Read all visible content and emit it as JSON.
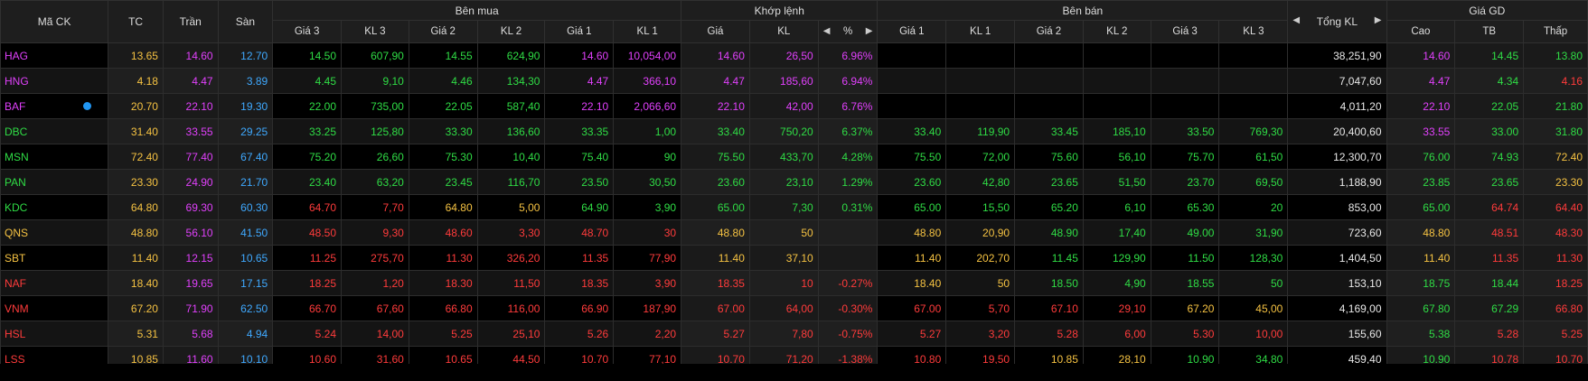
{
  "headers": {
    "symbol": "Mã CK",
    "ref": "TC",
    "ceil": "Trần",
    "floor": "Sàn",
    "buy_group": "Bên mua",
    "match_group": "Khớp lệnh",
    "sell_group": "Bên bán",
    "total": "Tổng KL",
    "price_group": "Giá GD",
    "buy": [
      "Giá 3",
      "KL 3",
      "Giá 2",
      "KL 2",
      "Giá 1",
      "KL 1"
    ],
    "match": [
      "Giá",
      "KL",
      "%"
    ],
    "sell": [
      "Giá 1",
      "KL 1",
      "Giá 2",
      "KL 2",
      "Giá 3",
      "KL 3"
    ],
    "price": [
      "Cao",
      "TB",
      "Thấp"
    ]
  },
  "colors": {
    "ceil": "#e040fb",
    "floor": "#3fa9ff",
    "ref": "#f5c242",
    "up": "#2fdc45",
    "down": "#ff3b3b"
  },
  "rows": [
    {
      "s": "HAG",
      "i": false,
      "ref": "13.65",
      "ceil": "14.60",
      "floor": "12.70",
      "b": [
        "14.50",
        "607,90",
        "14.55",
        "624,90",
        "14.60",
        "10,054,00"
      ],
      "m": [
        "14.60",
        "26,50",
        "6.96%"
      ],
      "a": [
        "",
        "",
        "",
        "",
        "",
        ""
      ],
      "tot": "38,251,90",
      "h": "14.60",
      "avg": "14.45",
      "l": "13.80"
    },
    {
      "s": "HNG",
      "i": false,
      "ref": "4.18",
      "ceil": "4.47",
      "floor": "3.89",
      "b": [
        "4.45",
        "9,10",
        "4.46",
        "134,30",
        "4.47",
        "366,10"
      ],
      "m": [
        "4.47",
        "185,60",
        "6.94%"
      ],
      "a": [
        "",
        "",
        "",
        "",
        "",
        ""
      ],
      "tot": "7,047,60",
      "h": "4.47",
      "avg": "4.34",
      "l": "4.16"
    },
    {
      "s": "BAF",
      "i": true,
      "ref": "20.70",
      "ceil": "22.10",
      "floor": "19.30",
      "b": [
        "22.00",
        "735,00",
        "22.05",
        "587,40",
        "22.10",
        "2,066,60"
      ],
      "m": [
        "22.10",
        "42,00",
        "6.76%"
      ],
      "a": [
        "",
        "",
        "",
        "",
        "",
        ""
      ],
      "tot": "4,011,20",
      "h": "22.10",
      "avg": "22.05",
      "l": "21.80"
    },
    {
      "s": "DBC",
      "i": false,
      "ref": "31.40",
      "ceil": "33.55",
      "floor": "29.25",
      "b": [
        "33.25",
        "125,80",
        "33.30",
        "136,60",
        "33.35",
        "1,00"
      ],
      "m": [
        "33.40",
        "750,20",
        "6.37%"
      ],
      "a": [
        "33.40",
        "119,90",
        "33.45",
        "185,10",
        "33.50",
        "769,30"
      ],
      "tot": "20,400,60",
      "h": "33.55",
      "avg": "33.00",
      "l": "31.80"
    },
    {
      "s": "MSN",
      "i": false,
      "ref": "72.40",
      "ceil": "77.40",
      "floor": "67.40",
      "b": [
        "75.20",
        "26,60",
        "75.30",
        "10,40",
        "75.40",
        "90"
      ],
      "m": [
        "75.50",
        "433,70",
        "4.28%"
      ],
      "a": [
        "75.50",
        "72,00",
        "75.60",
        "56,10",
        "75.70",
        "61,50"
      ],
      "tot": "12,300,70",
      "h": "76.00",
      "avg": "74.93",
      "l": "72.40"
    },
    {
      "s": "PAN",
      "i": false,
      "ref": "23.30",
      "ceil": "24.90",
      "floor": "21.70",
      "b": [
        "23.40",
        "63,20",
        "23.45",
        "116,70",
        "23.50",
        "30,50"
      ],
      "m": [
        "23.60",
        "23,10",
        "1.29%"
      ],
      "a": [
        "23.60",
        "42,80",
        "23.65",
        "51,50",
        "23.70",
        "69,50"
      ],
      "tot": "1,188,90",
      "h": "23.85",
      "avg": "23.65",
      "l": "23.30"
    },
    {
      "s": "KDC",
      "i": false,
      "ref": "64.80",
      "ceil": "69.30",
      "floor": "60.30",
      "b": [
        "64.70",
        "7,70",
        "64.80",
        "5,00",
        "64.90",
        "3,90"
      ],
      "m": [
        "65.00",
        "7,30",
        "0.31%"
      ],
      "a": [
        "65.00",
        "15,50",
        "65.20",
        "6,10",
        "65.30",
        "20"
      ],
      "tot": "853,00",
      "h": "65.00",
      "avg": "64.74",
      "l": "64.40"
    },
    {
      "s": "QNS",
      "i": false,
      "ref": "48.80",
      "ceil": "56.10",
      "floor": "41.50",
      "b": [
        "48.50",
        "9,30",
        "48.60",
        "3,30",
        "48.70",
        "30"
      ],
      "m": [
        "48.80",
        "50",
        ""
      ],
      "a": [
        "48.80",
        "20,90",
        "48.90",
        "17,40",
        "49.00",
        "31,90"
      ],
      "tot": "723,60",
      "h": "48.80",
      "avg": "48.51",
      "l": "48.30"
    },
    {
      "s": "SBT",
      "i": false,
      "ref": "11.40",
      "ceil": "12.15",
      "floor": "10.65",
      "b": [
        "11.25",
        "275,70",
        "11.30",
        "326,20",
        "11.35",
        "77,90"
      ],
      "m": [
        "11.40",
        "37,10",
        ""
      ],
      "a": [
        "11.40",
        "202,70",
        "11.45",
        "129,90",
        "11.50",
        "128,30"
      ],
      "tot": "1,404,50",
      "h": "11.40",
      "avg": "11.35",
      "l": "11.30"
    },
    {
      "s": "NAF",
      "i": false,
      "ref": "18.40",
      "ceil": "19.65",
      "floor": "17.15",
      "b": [
        "18.25",
        "1,20",
        "18.30",
        "11,50",
        "18.35",
        "3,90"
      ],
      "m": [
        "18.35",
        "10",
        "-0.27%"
      ],
      "a": [
        "18.40",
        "50",
        "18.50",
        "4,90",
        "18.55",
        "50"
      ],
      "tot": "153,10",
      "h": "18.75",
      "avg": "18.44",
      "l": "18.25"
    },
    {
      "s": "VNM",
      "i": false,
      "ref": "67.20",
      "ceil": "71.90",
      "floor": "62.50",
      "b": [
        "66.70",
        "67,60",
        "66.80",
        "116,00",
        "66.90",
        "187,90"
      ],
      "m": [
        "67.00",
        "64,00",
        "-0.30%"
      ],
      "a": [
        "67.00",
        "5,70",
        "67.10",
        "29,10",
        "67.20",
        "45,00"
      ],
      "tot": "4,169,00",
      "h": "67.80",
      "avg": "67.29",
      "l": "66.80"
    },
    {
      "s": "HSL",
      "i": false,
      "ref": "5.31",
      "ceil": "5.68",
      "floor": "4.94",
      "b": [
        "5.24",
        "14,00",
        "5.25",
        "25,10",
        "5.26",
        "2,20"
      ],
      "m": [
        "5.27",
        "7,80",
        "-0.75%"
      ],
      "a": [
        "5.27",
        "3,20",
        "5.28",
        "6,00",
        "5.30",
        "10,00"
      ],
      "tot": "155,60",
      "h": "5.38",
      "avg": "5.28",
      "l": "5.25"
    },
    {
      "s": "LSS",
      "i": false,
      "ref": "10.85",
      "ceil": "11.60",
      "floor": "10.10",
      "b": [
        "10.60",
        "31,60",
        "10.65",
        "44,50",
        "10.70",
        "77,10"
      ],
      "m": [
        "10.70",
        "71,20",
        "-1.38%"
      ],
      "a": [
        "10.80",
        "19,50",
        "10.85",
        "28,10",
        "10.90",
        "34,80"
      ],
      "tot": "459,40",
      "h": "10.90",
      "avg": "10.78",
      "l": "10.70"
    }
  ]
}
